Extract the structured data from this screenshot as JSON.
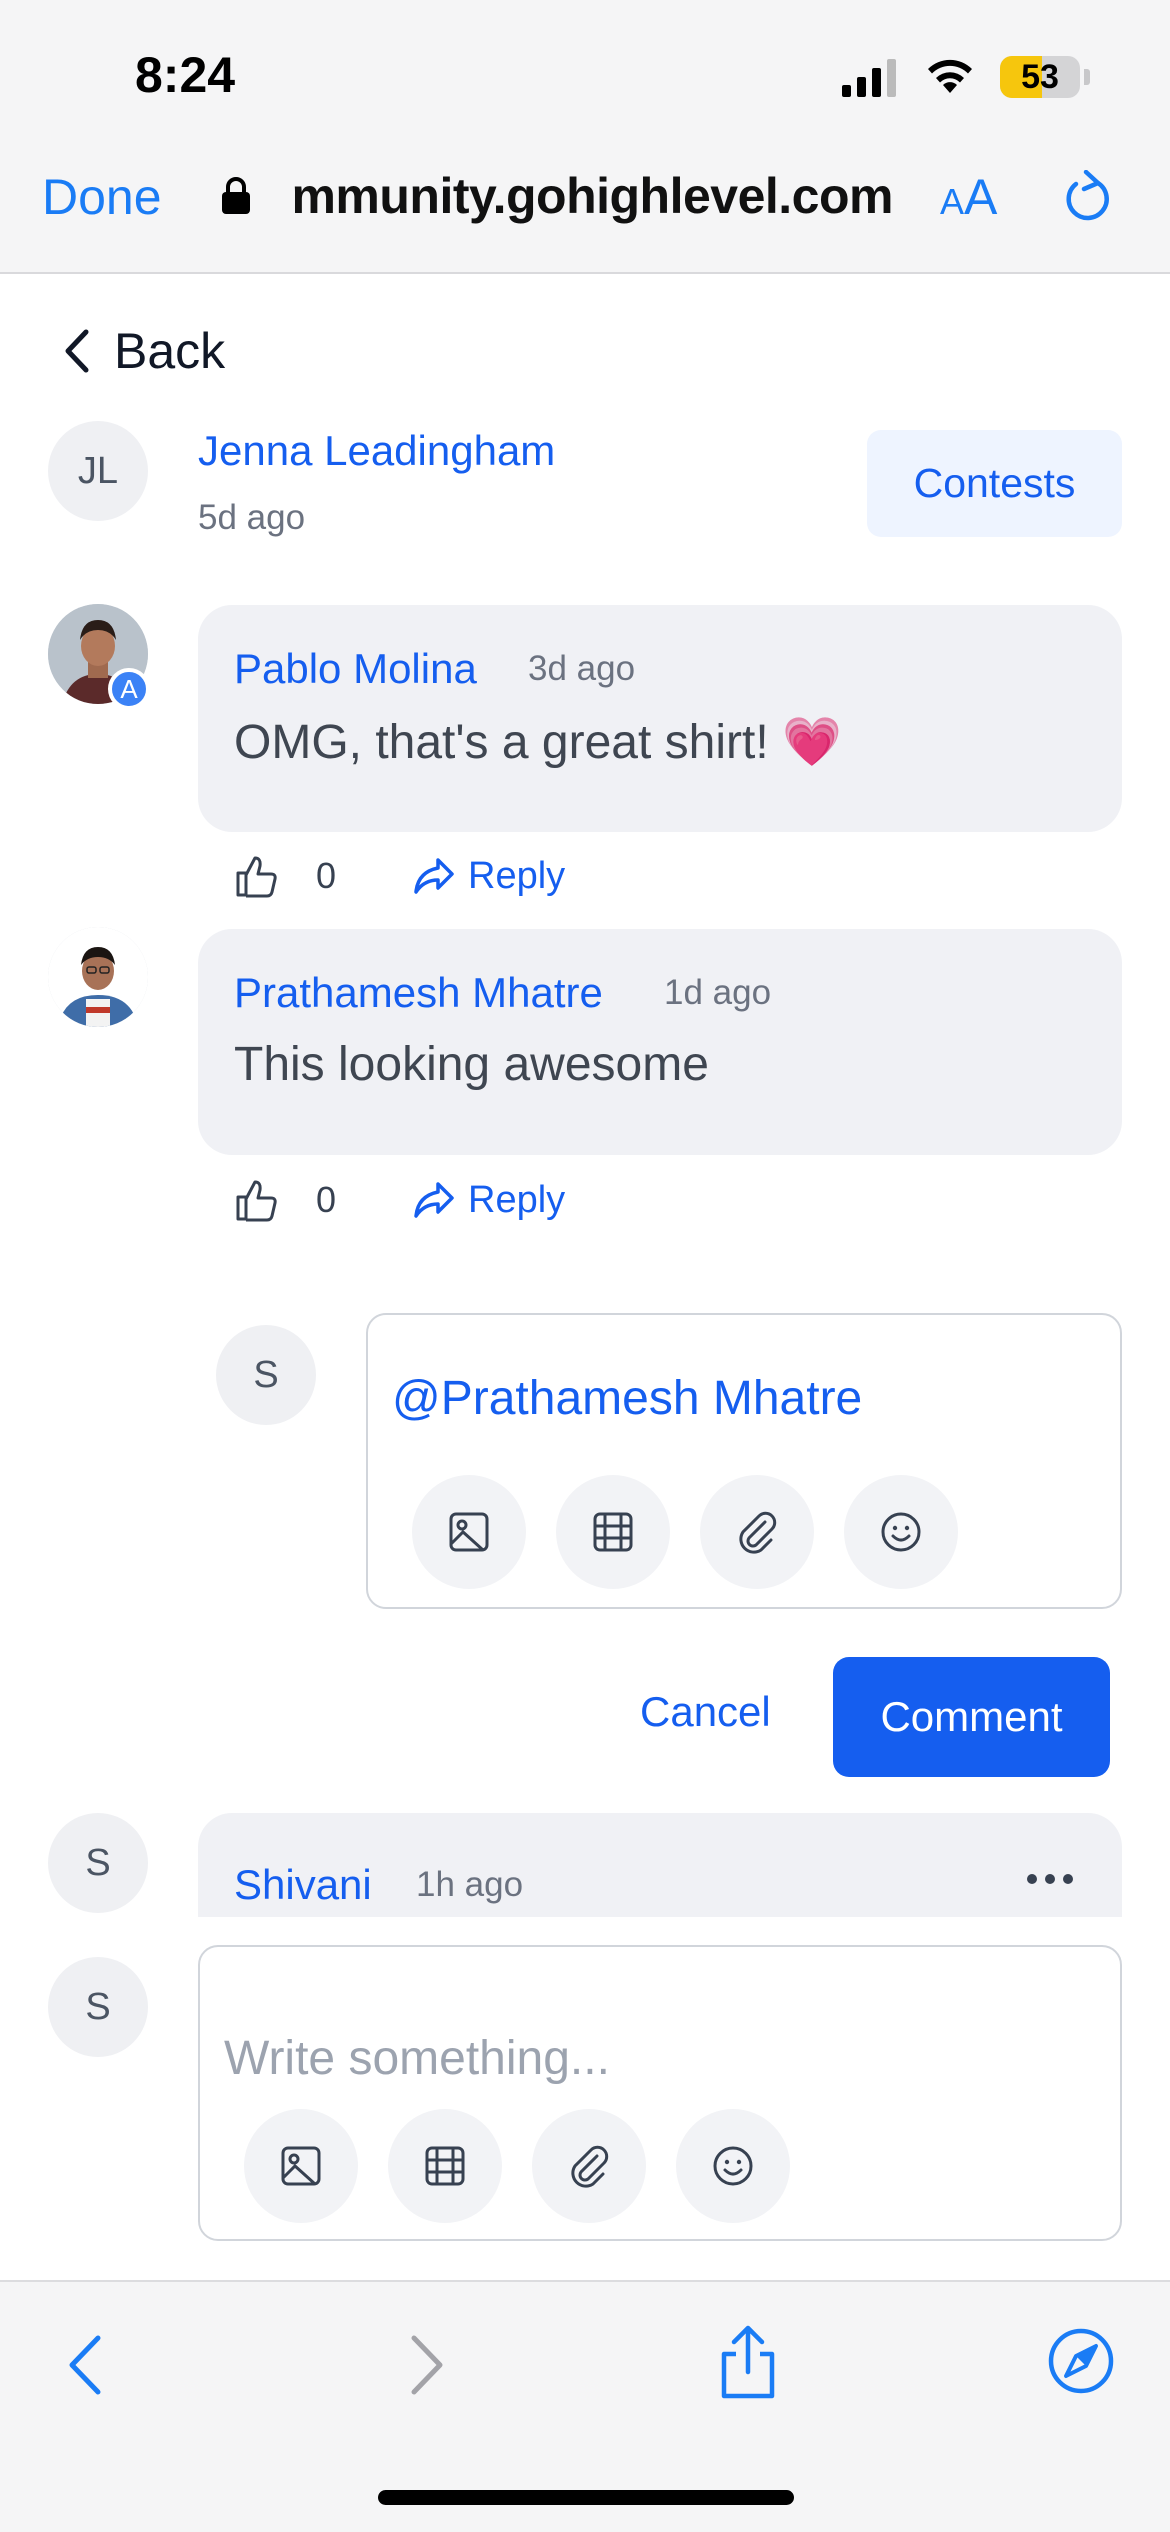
{
  "status_bar": {
    "time": "8:24",
    "battery_level": "53",
    "battery_fraction": 0.53
  },
  "browser": {
    "done_label": "Done",
    "url": "mmunity.gohighlevel.com",
    "text_size_small": "A",
    "text_size_large": "A"
  },
  "nav": {
    "back_label": "Back"
  },
  "post": {
    "author_initials": "JL",
    "author_name": "Jenna Leadingham",
    "time": "5d ago",
    "category_button": "Contests"
  },
  "comments": [
    {
      "author": "Pablo Molina",
      "time": "3d ago",
      "text": "OMG, that's a great shirt! 💗",
      "likes": "0",
      "reply_label": "Reply",
      "badge": "A"
    },
    {
      "author": "Prathamesh Mhatre",
      "time": "1d ago",
      "text": "This looking awesome",
      "likes": "0",
      "reply_label": "Reply"
    }
  ],
  "reply_editor": {
    "user_initial": "S",
    "value": "@Prathamesh Mhatre",
    "cancel_label": "Cancel",
    "submit_label": "Comment"
  },
  "partial_comment": {
    "user_initial": "S",
    "author": "Shivani",
    "time": "1h ago"
  },
  "new_comment": {
    "user_initial": "S",
    "placeholder": "Write something..."
  },
  "colors": {
    "brand": "#155eef",
    "safari_blue": "#1a7cf5",
    "bubble": "#f0f1f5"
  }
}
